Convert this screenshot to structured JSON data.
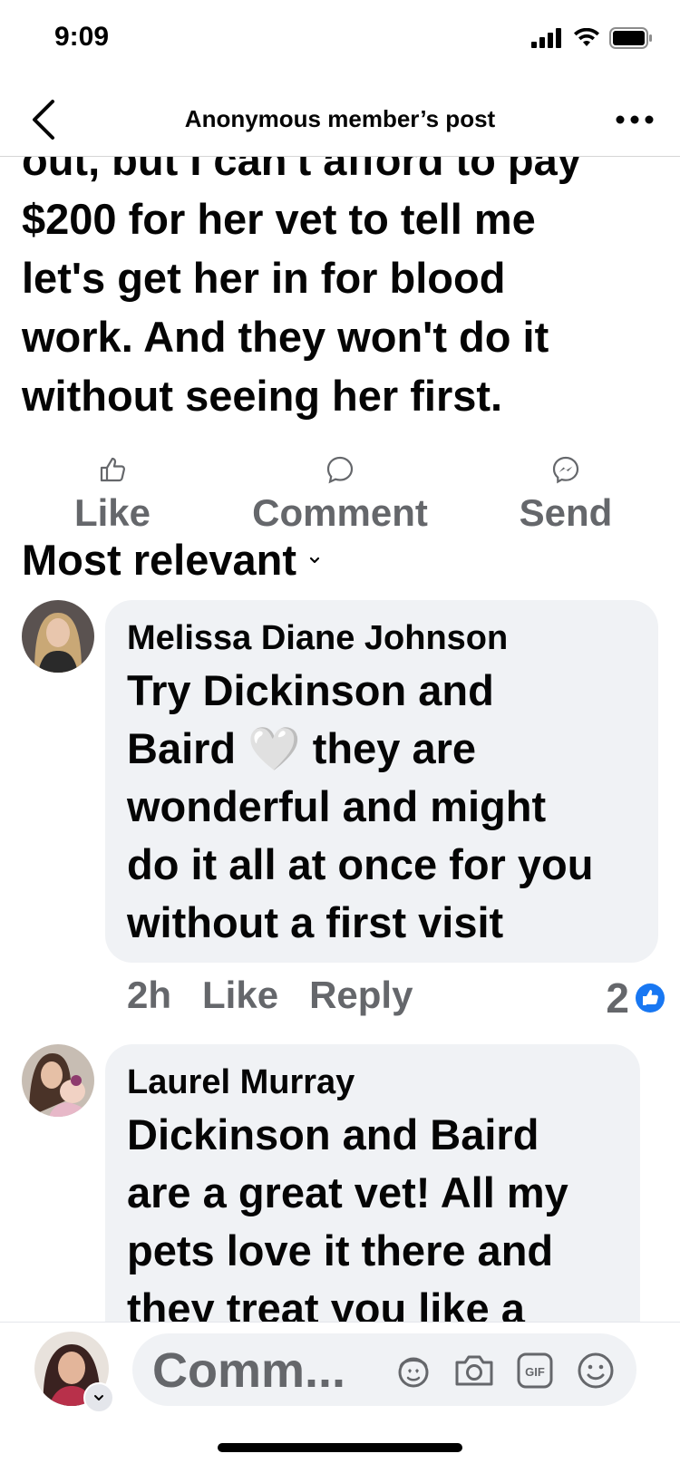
{
  "status_bar": {
    "time": "9:09"
  },
  "nav": {
    "title": "Anonymous member’s post"
  },
  "post": {
    "lines": [
      "out, but I can't afford to pay",
      "$200 for her vet to tell me",
      "let's get her in for blood",
      "work. And they won't do it",
      "without seeing her first."
    ]
  },
  "actions": {
    "like": "Like",
    "comment": "Comment",
    "send": "Send"
  },
  "sort": {
    "label": "Most relevant"
  },
  "comments": [
    {
      "author": "Melissa Diane Johnson",
      "lines": [
        "Try Dickinson and",
        "Baird 🤍 they are",
        "wonderful and might",
        "do it all at once for you",
        "without a first visit"
      ],
      "time": "2h",
      "like": "Like",
      "reply": "Reply",
      "reactions": "2"
    },
    {
      "author": "Laurel Murray",
      "lines": [
        "Dickinson and Baird",
        "are a great vet! All my",
        "pets love it there and",
        "they treat you like a"
      ]
    }
  ],
  "composer": {
    "placeholder": "Comm..."
  },
  "colors": {
    "accent": "#1877f2",
    "bubble": "#f0f2f5",
    "muted": "#65676b"
  }
}
